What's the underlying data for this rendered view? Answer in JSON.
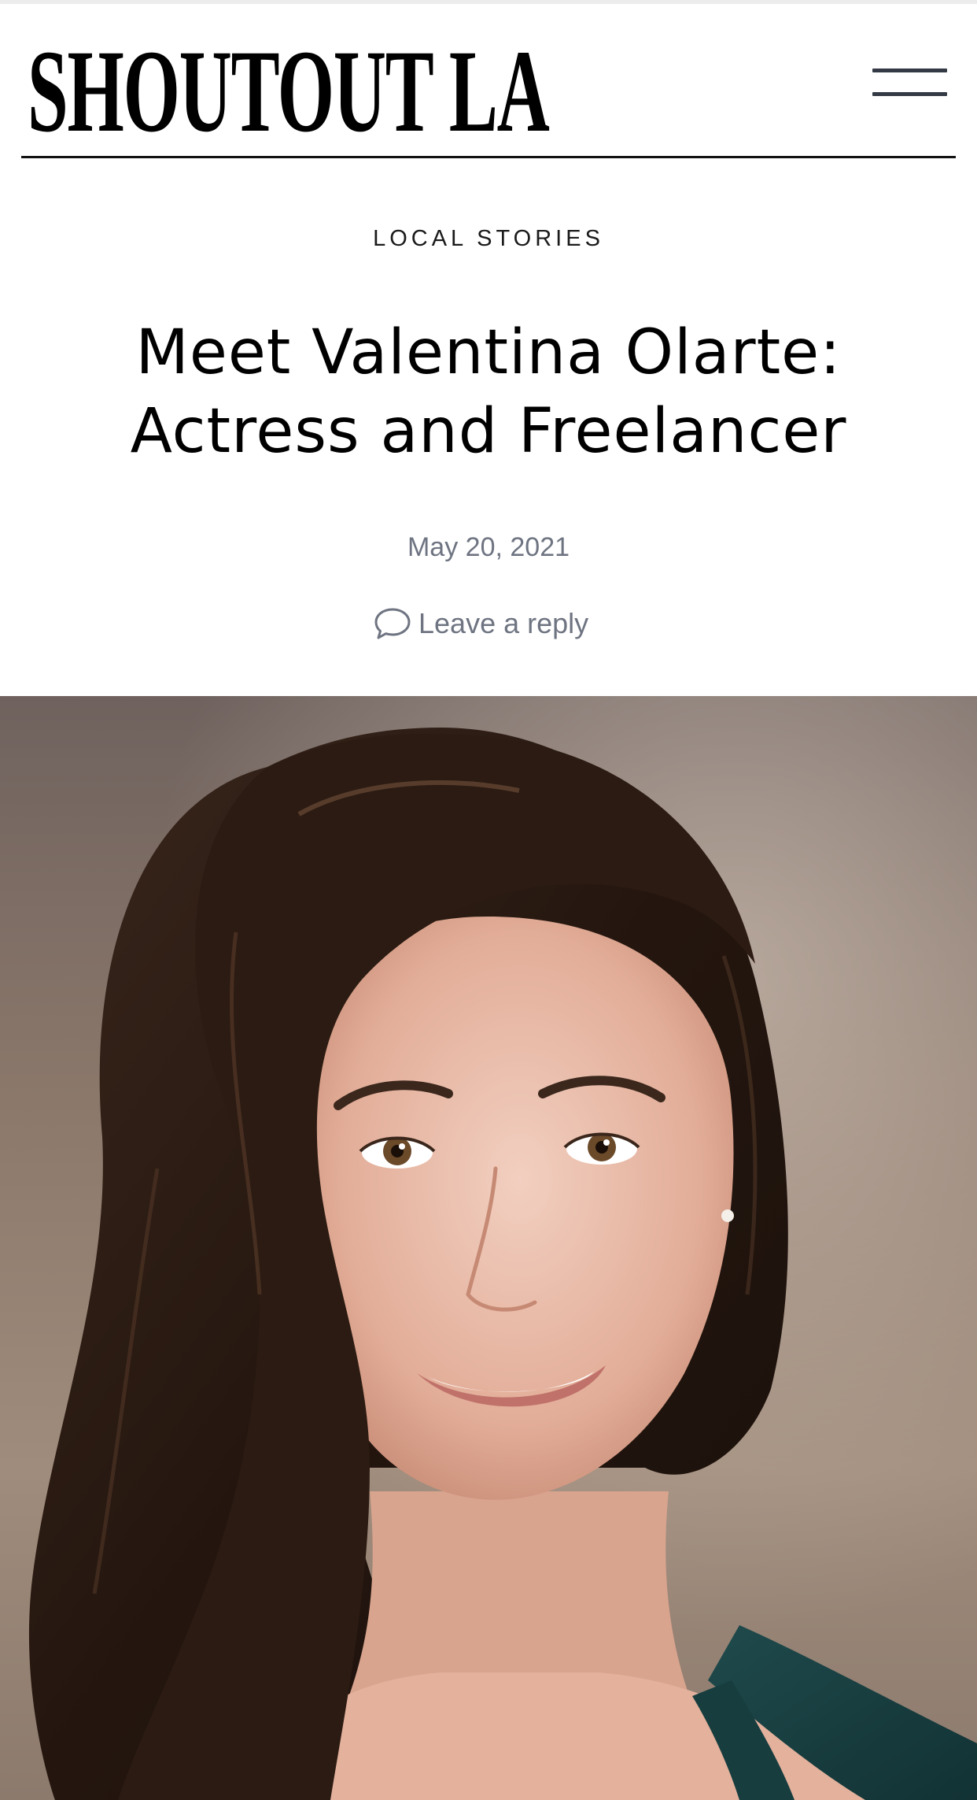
{
  "site": {
    "logo_text": "SHOUTOUT LA",
    "menu_icon": "hamburger-menu-icon"
  },
  "article": {
    "category": "LOCAL STORIES",
    "title": "Meet Valentina Olarte: Actress and Freelancer",
    "date": "May 20, 2021",
    "reply_label": "Leave a reply",
    "reply_icon": "comment-bubble-icon"
  },
  "hero_image": {
    "subject": "portrait-photo"
  },
  "colors": {
    "text": "#000000",
    "meta": "#6e7481",
    "menu_bars": "#333a45",
    "header_rule": "#111111"
  }
}
